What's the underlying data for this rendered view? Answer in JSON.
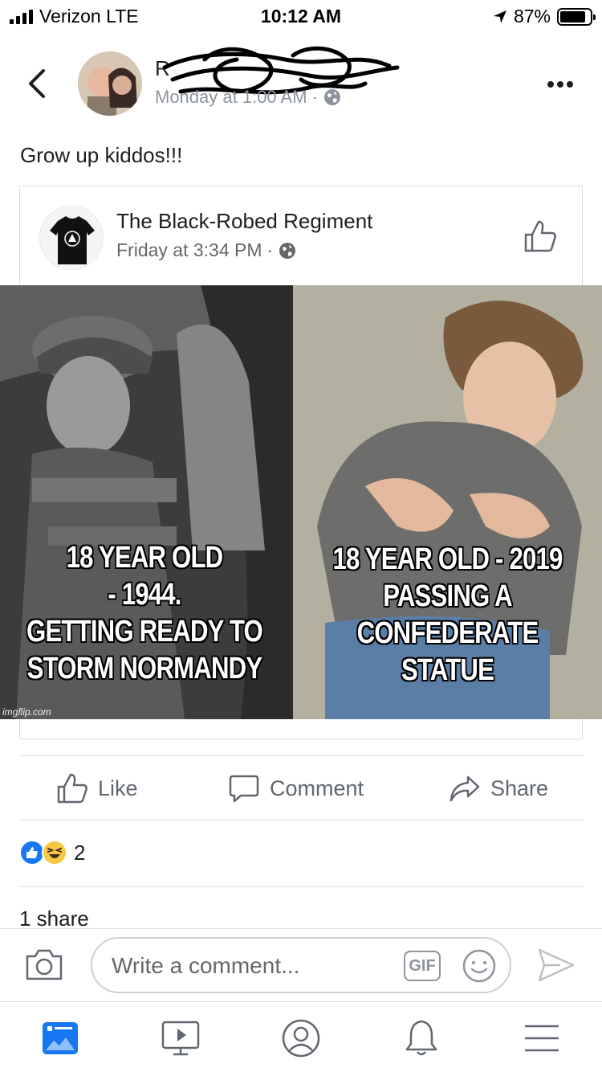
{
  "status_bar": {
    "carrier": "Verizon LTE",
    "time": "10:12 AM",
    "battery_percent": "87%",
    "battery_level": 0.87
  },
  "post": {
    "author_name": "R",
    "timestamp": "Monday at 1:00 AM",
    "meta_separator": "·",
    "text": "Grow up kiddos!!!"
  },
  "shared": {
    "page_name": "The Black-Robed Regiment",
    "timestamp": "Friday at 3:34 PM",
    "meta_separator": "·",
    "meme": {
      "caption_left": "18 YEAR OLD\n- 1944.\nGETTING READY TO\nSTORM NORMANDY",
      "caption_right": "18 YEAR OLD - 2019\nPASSING A\nCONFEDERATE STATUE",
      "watermark": "imgflip.com"
    }
  },
  "actions": {
    "like": "Like",
    "comment": "Comment",
    "share": "Share"
  },
  "engagement": {
    "reaction_count": "2",
    "shares": "1 share"
  },
  "comment_bar": {
    "placeholder": "Write a comment...",
    "gif_label": "GIF"
  },
  "icons": {
    "back": "chevron-left-icon",
    "more": "more-dots-icon",
    "globe": "globe-icon",
    "like": "thumbs-up-icon",
    "comment": "comment-icon",
    "share": "share-arrow-icon",
    "camera": "camera-icon",
    "emoji": "emoji-icon",
    "send": "send-icon",
    "tabs": [
      "news-feed-icon",
      "watch-icon",
      "profile-icon",
      "notifications-icon",
      "menu-icon"
    ]
  },
  "colors": {
    "accent": "#1877f2",
    "text": "#1c1e21",
    "muted": "#65676b",
    "haha": "#f7c843"
  }
}
